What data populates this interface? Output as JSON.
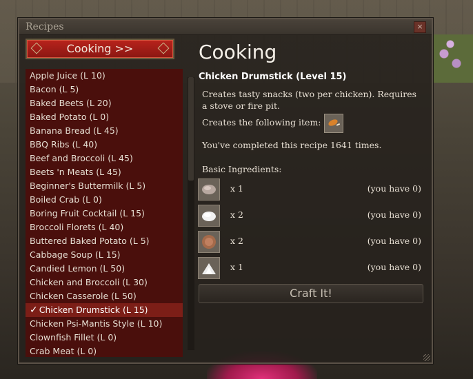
{
  "window": {
    "title": "Recipes",
    "close_label": "×"
  },
  "category_button": {
    "label": "Cooking >>"
  },
  "recipes": [
    {
      "label": "Apple Juice (L 10)"
    },
    {
      "label": "Bacon (L 5)"
    },
    {
      "label": "Baked Beets (L 20)"
    },
    {
      "label": "Baked Potato (L 0)"
    },
    {
      "label": "Banana Bread (L 45)"
    },
    {
      "label": "BBQ Ribs (L 40)"
    },
    {
      "label": "Beef and Broccoli (L 45)"
    },
    {
      "label": "Beets 'n Meats (L 45)"
    },
    {
      "label": "Beginner's Buttermilk (L 5)"
    },
    {
      "label": "Boiled Crab (L 0)"
    },
    {
      "label": "Boring Fruit Cocktail (L 15)"
    },
    {
      "label": "Broccoli Florets (L 40)"
    },
    {
      "label": "Buttered Baked Potato (L 5)"
    },
    {
      "label": "Cabbage Soup (L 15)"
    },
    {
      "label": "Candied Lemon (L 50)"
    },
    {
      "label": "Chicken and Broccoli (L 30)"
    },
    {
      "label": "Chicken Casserole (L 50)"
    },
    {
      "label": "Chicken Drumstick (L 15)",
      "selected": true
    },
    {
      "label": "Chicken Psi-Mantis Style (L 10)"
    },
    {
      "label": "Clownfish Fillet (L 0)"
    },
    {
      "label": "Crab Meat (L 0)"
    }
  ],
  "detail": {
    "heading": "Cooking",
    "recipe_title": "Chicken Drumstick (Level 15)",
    "description": "Creates tasty snacks (two per chicken). Requires a stove or fire pit.",
    "creates_label": "Creates the following item:",
    "completed_text": "You've completed this recipe 1641 times.",
    "ingredients_label": "Basic Ingredients:",
    "ingredients": [
      {
        "qty": "x 1",
        "have": "(you have 0)",
        "icon": "meat-icon"
      },
      {
        "qty": "x 2",
        "have": "(you have 0)",
        "icon": "salt-icon"
      },
      {
        "qty": "x 2",
        "have": "(you have 0)",
        "icon": "spice-icon"
      },
      {
        "qty": "x 1",
        "have": "(you have 0)",
        "icon": "flour-icon"
      }
    ],
    "craft_label": "Craft It!"
  },
  "check_mark": "✓",
  "colors": {
    "accent_red": "#b8231c",
    "list_bg": "#4a0f0c",
    "selected_row": "#7c1e17"
  }
}
